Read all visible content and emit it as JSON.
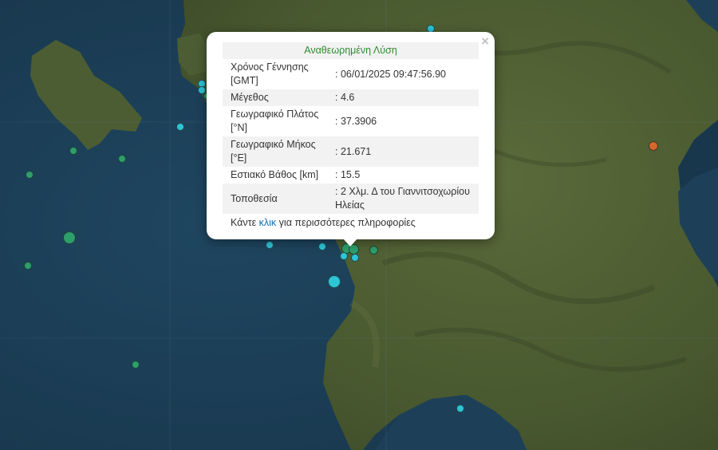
{
  "popup": {
    "title": "Αναθεωρημένη Λύση",
    "close_glyph": "×",
    "rows": [
      {
        "label": "Χρόνος Γέννησης [GMT]",
        "value": ": 06/01/2025 09:47:56.90"
      },
      {
        "label": "Μέγεθος",
        "value": ": 4.6"
      },
      {
        "label": "Γεωγραφικό Πλάτος [°N]",
        "value": ": 37.3906"
      },
      {
        "label": "Γεωγραφικό Μήκος [°E]",
        "value": ": 21.671"
      },
      {
        "label": "Εστιακό Βάθος [km]",
        "value": ": 15.5"
      },
      {
        "label": "Τοποθεσία",
        "value": ": 2 Χλμ. Δ του Γιαννιτσοχωρίου Ηλείας"
      }
    ],
    "more_prefix": "Κάντε ",
    "more_link": "κλικ",
    "more_suffix": " για περισσότερες πληροφορίες"
  },
  "colors": {
    "sea": "#1a3a52",
    "land": "#4a5a33",
    "marker_green": "#2e9e6a",
    "marker_cyan": "#2ec4d6",
    "marker_orange": "#d9662a",
    "title_green": "#2e8b2e",
    "link_blue": "#0b6fb3"
  }
}
